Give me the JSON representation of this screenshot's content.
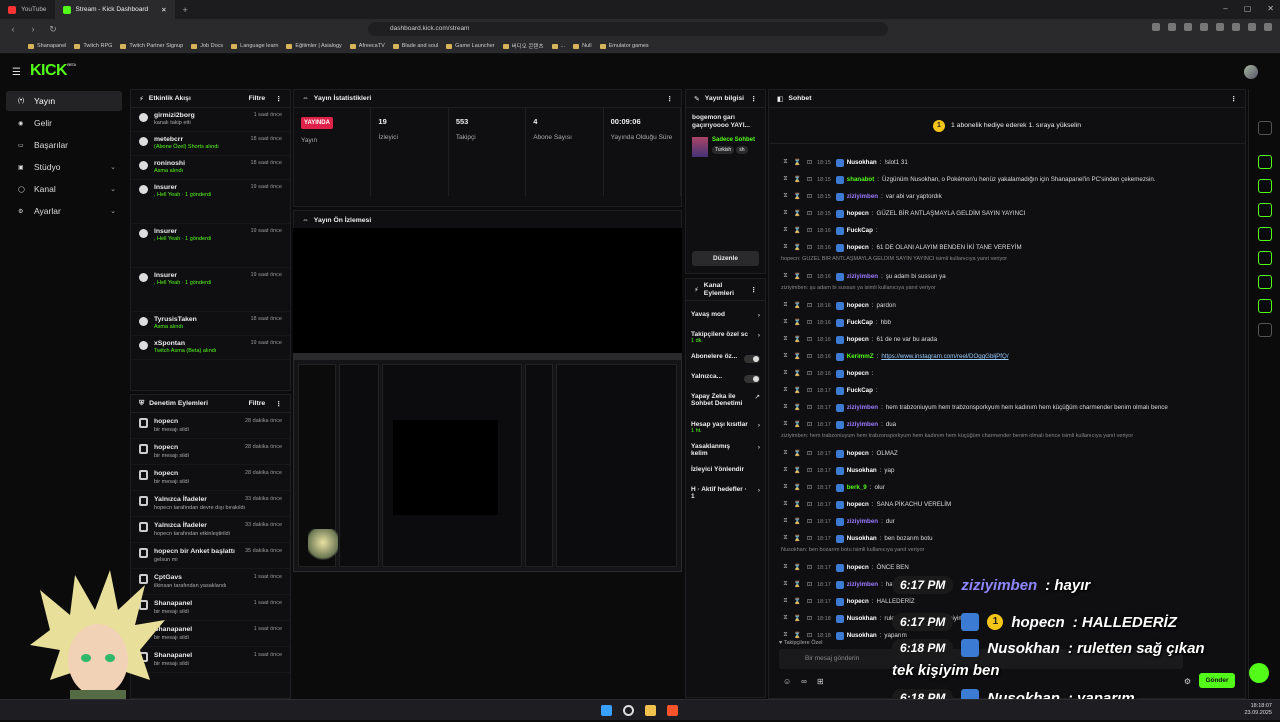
{
  "browser": {
    "tabs": [
      {
        "label": "YouTube",
        "color": "#ff3333"
      },
      {
        "label": "Stream - Kick Dashboard",
        "color": "#53fc18"
      }
    ],
    "url": "dashboard.kick.com/stream",
    "bookmarks": [
      "Shanapanel",
      "Twitch RPG",
      "Twitch Partner Signup",
      "Job Docs",
      "Language learn",
      "Eğitimler | Asialogy",
      "AfreecaTV",
      "Blade and soul",
      "Game Launcher",
      "버디오 콘텐츠",
      "...",
      "Null",
      "Emulator games"
    ]
  },
  "app": {
    "logo": "KICK",
    "logo_sup": "BETA"
  },
  "sidebar": {
    "items": [
      {
        "label": "Yayın",
        "active": true
      },
      {
        "label": "Gelir"
      },
      {
        "label": "Başarılar"
      },
      {
        "label": "Stüdyo",
        "chev": true
      },
      {
        "label": "Kanal",
        "chev": true
      },
      {
        "label": "Ayarlar",
        "chev": true
      }
    ]
  },
  "activity": {
    "title": "Etkinlik Akışı",
    "filter": "Filtre",
    "rows": [
      {
        "name": "girmizi2borg",
        "sub": "kanalı takip etti",
        "time": "1 saat önce",
        "green": false
      },
      {
        "name": "metebcrr",
        "sub": "(Abone Özel) Shorts alındı",
        "time": "18 saat önce",
        "green": true
      },
      {
        "name": "roninoshi",
        "sub": "Asma alındı",
        "time": "18 saat önce",
        "green": true
      },
      {
        "name": "lnsurer",
        "sub": ", Hell Yeah · 1 gönderdi",
        "time": "19 saat önce",
        "green": true
      },
      {
        "name": "lnsurer",
        "sub": ", Hell Yeah · 1 gönderdi",
        "time": "19 saat önce",
        "green": true
      },
      {
        "name": "lnsurer",
        "sub": ", Hell Yeah · 1 gönderdi",
        "time": "19 saat önce",
        "green": true
      },
      {
        "name": "TyrusisTaken",
        "sub": "Asma alındı",
        "time": "18 saat önce",
        "green": true
      },
      {
        "name": "xSpontan",
        "sub": "Twitch Asma (Beta) alındı",
        "time": "19 saat önce",
        "green": true
      }
    ]
  },
  "stats": {
    "title": "Yayın İstatistikleri",
    "items": [
      {
        "value": "YAYINDA",
        "label": "Yayın"
      },
      {
        "value": "19",
        "label": "İzleyici"
      },
      {
        "value": "553",
        "label": "Takipçi"
      },
      {
        "value": "4",
        "label": "Abone Sayısı"
      },
      {
        "value": "00:09:06",
        "label": "Yayında Olduğu Süre"
      }
    ]
  },
  "preview": {
    "title": "Yayın Ön İzlemesi"
  },
  "info": {
    "title": "Yayın bilgisi",
    "stream_title": "bogemon garı gaçırıyoooo YAYI...",
    "category": "Sadece Sohbet",
    "tags": [
      "Turkish",
      "sh"
    ],
    "edit": "Düzenle"
  },
  "channel_actions": {
    "title": "Kanal Eylemleri",
    "items": [
      {
        "label": "Yavaş mod",
        "sub": "",
        "kind": "arrow"
      },
      {
        "label": "Takipçilere özel sc",
        "sub": "1 dk.",
        "kind": "arrow"
      },
      {
        "label": "Abonelere öz...",
        "sub": "",
        "kind": "toggle"
      },
      {
        "label": "Yalnızca...",
        "sub": "",
        "kind": "toggle"
      },
      {
        "label": "Yapay Zeka ile Sohbet Denetimi",
        "sub": "",
        "kind": "ext"
      },
      {
        "label": "Hesap yaşı kısıtlar",
        "sub": "1 ht.",
        "kind": "arrow"
      },
      {
        "label": "Yasaklanmış kelim",
        "sub": "",
        "kind": "arrow"
      },
      {
        "label": "İzleyici Yönlendir",
        "sub": "",
        "kind": "none"
      },
      {
        "label": "H · Aktif hedefler · 1",
        "sub": "",
        "kind": "arrow"
      }
    ]
  },
  "mod": {
    "title": "Denetim Eylemleri",
    "filter": "Filtre",
    "rows": [
      {
        "name": "hopecn",
        "sub": "bir mesajı sildi",
        "time": "28 dakika önce"
      },
      {
        "name": "hopecn",
        "sub": "bir mesajı sildi",
        "time": "28 dakika önce"
      },
      {
        "name": "hopecn",
        "sub": "bir mesajı sildi",
        "time": "28 dakika önce"
      },
      {
        "name": "Yalnızca İfadeler",
        "sub": "hopecn tarafından devre dışı bırakıldı",
        "time": "33 dakika önce"
      },
      {
        "name": "Yalnızca İfadeler",
        "sub": "hopecn tarafından etkinleştirildi",
        "time": "33 dakika önce"
      },
      {
        "name": "hopecn bir Anket başlattı",
        "sub": "gelsun mi",
        "time": "35 dakika önce"
      },
      {
        "name": "CptGavs",
        "sub": "ilkinsan tarafından yasaklandı",
        "time": "1 saat önce"
      },
      {
        "name": "Shanapanel",
        "sub": "bir mesajı sildi",
        "time": "1 saat önce"
      },
      {
        "name": "Shanapanel",
        "sub": "bir mesajı sildi",
        "time": "1 saat önce"
      },
      {
        "name": "Shanapanel",
        "sub": "bir mesajı sildi",
        "time": "1 saat önce"
      }
    ]
  },
  "chat": {
    "title": "Sohbet",
    "banner": "1 abonelik hediye ederek 1. sıraya yükselin",
    "placeholder": "Bir mesaj gönderin",
    "followers_only": "Takipçilere Özel",
    "send": "Gönder",
    "messages": [
      {
        "time": "18:15",
        "user": "Nusokhan",
        "color": "#ffffff",
        "text": "!slot1 31"
      },
      {
        "time": "18:15",
        "user": "shanabot",
        "color": "#53fc18",
        "text": "Üzgünüm Nusokhan, o Pokémon'u henüz yakalamadığın için Shanapanel'in PC'sinden çekemezsin."
      },
      {
        "time": "18:15",
        "user": "ziziyimben",
        "color": "#9b7bff",
        "text": "var abi var yaptordık"
      },
      {
        "time": "18:15",
        "user": "hopecn",
        "color": "#ffffff",
        "text": "GÜZEL BİR ANTLAŞMAYLA GELDİM SAYIN YAYINCI"
      },
      {
        "time": "18:16",
        "user": "FuckCap",
        "color": "#ffffff",
        "text": ""
      },
      {
        "time": "18:16",
        "user": "hopecn",
        "color": "#ffffff",
        "text": "61 DE OLANI ALAYIM BENDEN İKİ TANE VEREYİM"
      },
      {
        "reply": "hopecn: GÜZEL BİR ANTLAŞMAYLA GELDİM SAYIN YAYINCI isimli kullanıcıya yanıt veriyor"
      },
      {
        "time": "18:16",
        "user": "ziziyimben",
        "color": "#9b7bff",
        "text": "şu adam bi sussun ya"
      },
      {
        "reply": "ziziyimben: şu adam bi sussun ya isimli kullanıcıya yanıt veriyor"
      },
      {
        "time": "18:16",
        "user": "hopecn",
        "color": "#ffffff",
        "text": "pardon"
      },
      {
        "time": "18:16",
        "user": "FuckCap",
        "color": "#ffffff",
        "text": "hbb"
      },
      {
        "time": "18:16",
        "user": "hopecn",
        "color": "#ffffff",
        "text": "61 de ne var bu arada"
      },
      {
        "time": "18:16",
        "user": "KerimmZ",
        "color": "#53fc18",
        "text": "https://www.instagram.com/reel/DOggGbljPfQ/",
        "link": true
      },
      {
        "time": "18:16",
        "user": "hopecn",
        "color": "#ffffff",
        "text": ""
      },
      {
        "time": "18:17",
        "user": "FuckCap",
        "color": "#ffffff",
        "text": ""
      },
      {
        "time": "18:17",
        "user": "ziziyimben",
        "color": "#9b7bff",
        "text": "hem trabzoniuyum hem trabzonsporkyum hem kadınım hem küçüğüm charmender benim olmalı bence"
      },
      {
        "time": "18:17",
        "user": "ziziyimben",
        "color": "#9b7bff",
        "text": "dua"
      },
      {
        "reply": "ziziyimben: hem trabzoniuyum hem trabzonsporkyum hem kadınım hem küçüğüm charmender benim olmalı bence isimli kullanıcıya yanıt veriyor"
      },
      {
        "time": "18:17",
        "user": "hopecn",
        "color": "#ffffff",
        "text": "OLMAZ"
      },
      {
        "time": "18:17",
        "user": "Nusokhan",
        "color": "#ffffff",
        "text": "yap"
      },
      {
        "time": "18:17",
        "user": "berk_9",
        "color": "#53fc18",
        "text": "olur"
      },
      {
        "time": "18:17",
        "user": "hopecn",
        "color": "#ffffff",
        "text": "SANA PİKACHU VERELİM"
      },
      {
        "time": "18:17",
        "user": "ziziyimben",
        "color": "#9b7bff",
        "text": "dur"
      },
      {
        "time": "18:17",
        "user": "Nusokhan",
        "color": "#ffffff",
        "text": "ben bozarım botu"
      },
      {
        "reply": "Nusokhan: ben bozarım botu isimli kullanıcıya yanıt veriyor"
      },
      {
        "time": "18:17",
        "user": "hopecn",
        "color": "#ffffff",
        "text": "ÖNCE BEN"
      },
      {
        "time": "18:17",
        "user": "ziziyimben",
        "color": "#9b7bff",
        "text": "hayır"
      },
      {
        "time": "18:17",
        "user": "hopecn",
        "color": "#ffffff",
        "text": "HALLEDERİZ"
      },
      {
        "time": "18:18",
        "user": "Nusokhan",
        "color": "#ffffff",
        "text": "ruletten sağ çıkan tek kişiyim ben"
      },
      {
        "time": "18:18",
        "user": "Nusokhan",
        "color": "#ffffff",
        "text": "yaparım"
      }
    ]
  },
  "overlay": [
    {
      "time": "6:17 PM",
      "user": "ziziyimben",
      "color": "#8f86ff",
      "text": ": hayır",
      "badges": false
    },
    {
      "time": "6:17 PM",
      "user": "hopecn",
      "color": "#ffffff",
      "text": ": HALLEDERİZ",
      "badges": true
    },
    {
      "time": "6:18 PM",
      "user": "Nusokhan",
      "color": "#ffffff",
      "text": ": ruletten sağ çıkan",
      "badges": true
    },
    {
      "time": "",
      "user": "",
      "color": "#ffffff",
      "text": "tek kişiyim ben",
      "badges": false
    },
    {
      "time": "6:18 PM",
      "user": "Nusokhan",
      "color": "#ffffff",
      "text": ": yaparım",
      "badges": true
    }
  ],
  "clock": {
    "time": "18:18:07",
    "date": "23.09.2025"
  },
  "colors": {
    "accent": "#53fc18",
    "live": "#e0224a",
    "coin": "#f5c518"
  }
}
